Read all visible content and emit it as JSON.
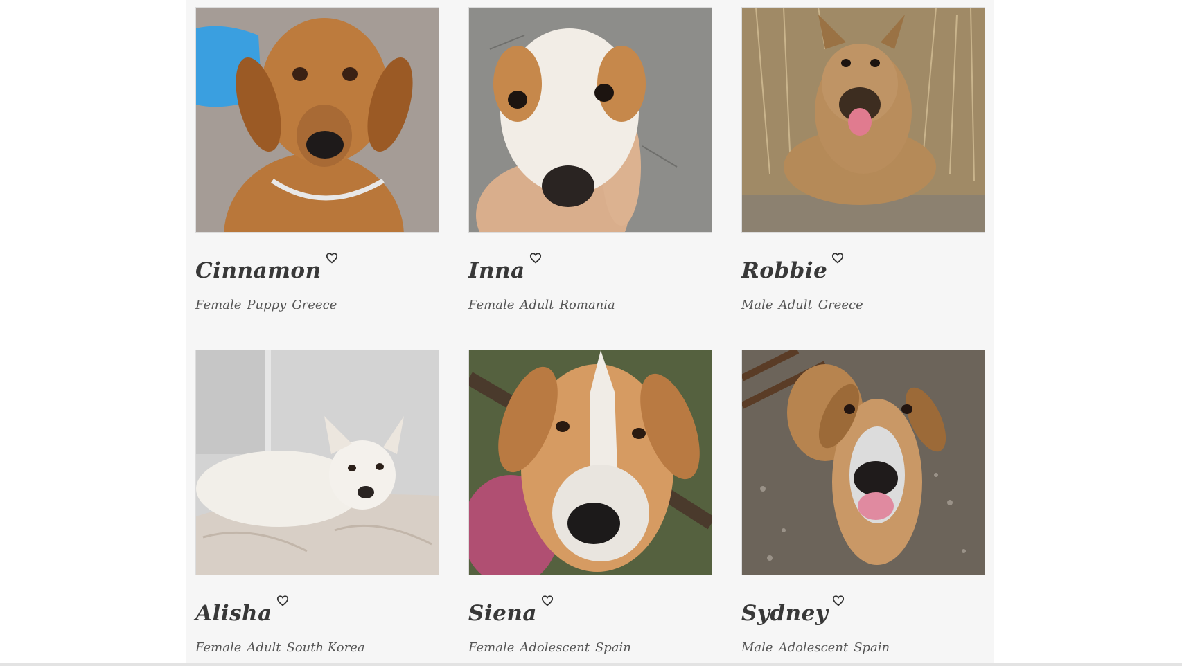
{
  "dogs": [
    {
      "name": "Cinnamon",
      "sex": "Female",
      "age": "Puppy",
      "country": "Greece",
      "coat": "#b9773a",
      "muzzle": "#8f5426",
      "bg": "#9a8f88",
      "accent": "#3a9fe0"
    },
    {
      "name": "Inna",
      "sex": "Female",
      "age": "Adult",
      "country": "Romania",
      "coat": "#f4efe8",
      "muzzle": "#c7894c",
      "bg": "#8a8a87",
      "accent": "#e2b08a"
    },
    {
      "name": "Robbie",
      "sex": "Male",
      "age": "Adult",
      "country": "Greece",
      "coat": "#b98d5c",
      "muzzle": "#3d2d20",
      "bg": "#a89370",
      "accent": "#d9c39a"
    },
    {
      "name": "Alisha",
      "sex": "Female",
      "age": "Adult",
      "country": "South Korea",
      "coat": "#f2efe9",
      "muzzle": "#d9cfc4",
      "bg": "#cfcfcf",
      "accent": "#cfc5bb"
    },
    {
      "name": "Siena",
      "sex": "Female",
      "age": "Adolescent",
      "country": "Spain",
      "coat": "#d69b62",
      "muzzle": "#f0ece6",
      "bg": "#4f5a3f",
      "accent": "#b04f72"
    },
    {
      "name": "Sydney",
      "sex": "Male",
      "age": "Adolescent",
      "country": "Spain",
      "coat": "#c99866",
      "muzzle": "#dcdcdc",
      "bg": "#6c645a",
      "accent": "#e08aa0"
    }
  ],
  "icons": {
    "favorite": "heart-outline-icon"
  }
}
